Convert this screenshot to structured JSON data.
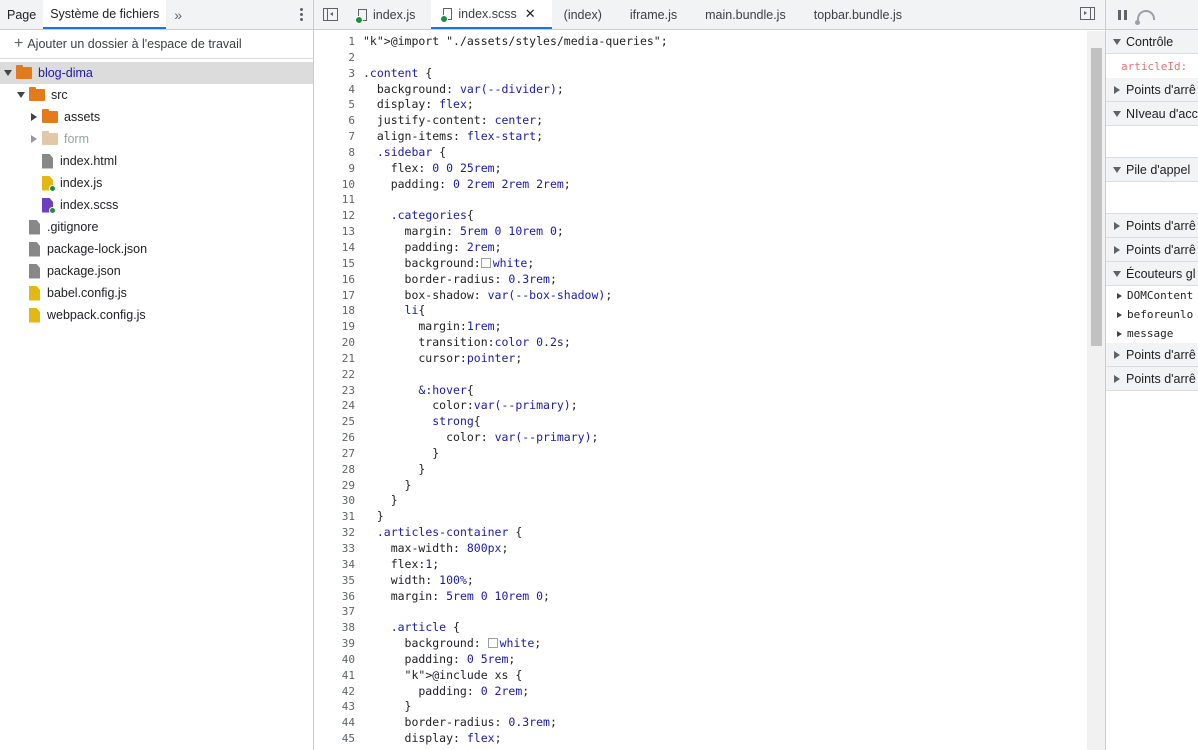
{
  "left_panel": {
    "tabs": [
      "Page",
      "Système de fichiers"
    ],
    "more_icon": "chevron-double-right-icon",
    "add_workspace_label": "Ajouter un dossier à l'espace de travail",
    "tree": [
      {
        "label": "blog-dima",
        "type": "folder",
        "level": 0,
        "expanded": true,
        "selected": true
      },
      {
        "label": "src",
        "type": "folder",
        "level": 1,
        "expanded": true
      },
      {
        "label": "assets",
        "type": "folder",
        "level": 2,
        "expanded": false
      },
      {
        "label": "form",
        "type": "folder",
        "level": 2,
        "expanded": false,
        "dim": true
      },
      {
        "label": "index.html",
        "type": "file",
        "ftype": "generic",
        "level": 2
      },
      {
        "label": "index.js",
        "type": "file",
        "ftype": "js",
        "level": 2,
        "mapped": true
      },
      {
        "label": "index.scss",
        "type": "file",
        "ftype": "scss",
        "level": 2,
        "mapped": true
      },
      {
        "label": ".gitignore",
        "type": "file",
        "ftype": "generic",
        "level": 1
      },
      {
        "label": "package-lock.json",
        "type": "file",
        "ftype": "generic",
        "level": 1
      },
      {
        "label": "package.json",
        "type": "file",
        "ftype": "generic",
        "level": 1
      },
      {
        "label": "babel.config.js",
        "type": "file",
        "ftype": "js",
        "level": 1
      },
      {
        "label": "webpack.config.js",
        "type": "file",
        "ftype": "js",
        "level": 1
      }
    ]
  },
  "editor": {
    "tabs": [
      {
        "label": "index.js",
        "icon": true,
        "active": false
      },
      {
        "label": "index.scss",
        "icon": true,
        "active": true,
        "closable": true
      },
      {
        "label": "(index)",
        "icon": false,
        "active": false
      },
      {
        "label": "iframe.js",
        "icon": false,
        "active": false
      },
      {
        "label": "main.bundle.js",
        "icon": false,
        "active": false
      },
      {
        "label": "topbar.bundle.js",
        "icon": false,
        "active": false
      }
    ],
    "close_glyph": "✕",
    "code_lines": [
      "@import \"./assets/styles/media-queries\";",
      "",
      ".content {",
      "  background: var(--divider);",
      "  display: flex;",
      "  justify-content: center;",
      "  align-items: flex-start;",
      "  .sidebar {",
      "    flex: 0 0 25rem;",
      "    padding: 0 2rem 2rem 2rem;",
      "",
      "    .categories{",
      "      margin: 5rem 0 10rem 0;",
      "      padding: 2rem;",
      "      background:□white;",
      "      border-radius: 0.3rem;",
      "      box-shadow: var(--box-shadow);",
      "      li{",
      "        margin:1rem;",
      "        transition:color 0.2s;",
      "        cursor:pointer;",
      "",
      "        &:hover{",
      "          color:var(--primary);",
      "          strong{",
      "            color: var(--primary);",
      "          }",
      "        }",
      "      }",
      "    }",
      "  }",
      "  .articles-container {",
      "    max-width: 800px;",
      "    flex:1;",
      "    width: 100%;",
      "    margin: 5rem 0 10rem 0;",
      "",
      "    .article {",
      "      background: □white;",
      "      padding: 0 5rem;",
      "      @include xs {",
      "        padding: 0 2rem;",
      "      }",
      "      border-radius: 0.3rem;",
      "      display: flex;"
    ]
  },
  "right_panel": {
    "sections": [
      {
        "label": "Contrôle",
        "expanded": true,
        "children": [
          {
            "text": "articleId:"
          }
        ]
      },
      {
        "label": "Points d'arrê",
        "expanded": false
      },
      {
        "label": "NIveau d'acc",
        "expanded": true,
        "blank": true
      },
      {
        "label": "Pile d'appel",
        "expanded": true,
        "blank": true
      },
      {
        "label": "Points d'arrê",
        "expanded": false
      },
      {
        "label": "Points d'arrê",
        "expanded": false
      },
      {
        "label": "Écouteurs gl",
        "expanded": true,
        "children": [
          {
            "text": "DOMContent"
          },
          {
            "text": "beforeunlo"
          },
          {
            "text": "message"
          }
        ]
      },
      {
        "label": "Points d'arrê",
        "expanded": false
      },
      {
        "label": "Points d'arrê",
        "expanded": false
      }
    ]
  },
  "colors": {
    "accent": "#1a73e8",
    "folder": "#e37b1c",
    "js": "#e3b714",
    "scss": "#6e3fbf",
    "mapped_dot": "#1e8e3e"
  }
}
